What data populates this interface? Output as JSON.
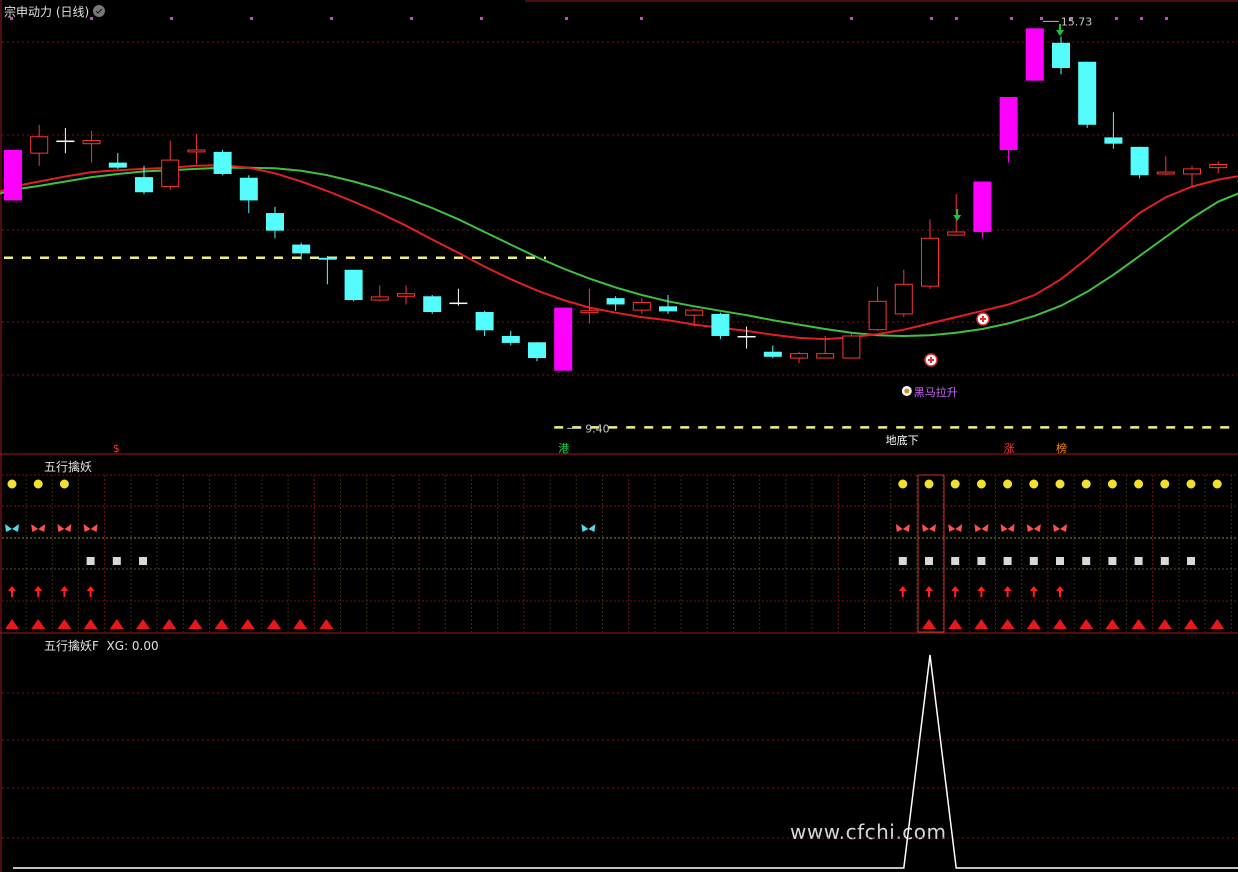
{
  "title": "宗申动力 (日线)",
  "indicator1_title": "五行擒妖",
  "indicator2_title": "五行擒妖F",
  "indicator2_value_label": "XG: 0.00",
  "watermark": "www.cfchi.com",
  "colors": {
    "up": "#ff3333",
    "down": "#54fcfc",
    "limit_up": "#ff00ff",
    "ma_fast": "#e02020",
    "ma_slow": "#40c040",
    "dash_line": "#f0f080",
    "grid_red": "#7a1010"
  },
  "chart_data": [
    {
      "type": "candlestick",
      "name": "price",
      "price_range": [
        9.2,
        16.1
      ],
      "high_label": "15.73",
      "low_label": "9.40",
      "dashed_levels": [
        {
          "price": 12.09,
          "from_index": 0,
          "to_index": 20
        },
        {
          "price": 9.4,
          "from_index": 21,
          "to_index": 47
        }
      ],
      "candles": [
        {
          "o": 13.0,
          "c": 13.8,
          "h": 13.8,
          "l": 13.0,
          "kind": "limit_up"
        },
        {
          "o": 13.75,
          "c": 14.01,
          "h": 14.2,
          "l": 13.55,
          "kind": "up"
        },
        {
          "o": 13.95,
          "c": 13.95,
          "h": 14.15,
          "l": 13.75,
          "kind": "doji"
        },
        {
          "o": 13.9,
          "c": 13.95,
          "h": 14.1,
          "l": 13.6,
          "kind": "up"
        },
        {
          "o": 13.6,
          "c": 13.52,
          "h": 13.75,
          "l": 13.5,
          "kind": "down"
        },
        {
          "o": 13.37,
          "c": 13.13,
          "h": 13.55,
          "l": 13.1,
          "kind": "down"
        },
        {
          "o": 13.22,
          "c": 13.64,
          "h": 13.95,
          "l": 13.17,
          "kind": "up"
        },
        {
          "o": 13.77,
          "c": 13.8,
          "h": 14.05,
          "l": 13.57,
          "kind": "up"
        },
        {
          "o": 13.77,
          "c": 13.42,
          "h": 13.8,
          "l": 13.4,
          "kind": "down"
        },
        {
          "o": 13.36,
          "c": 13.0,
          "h": 13.4,
          "l": 12.8,
          "kind": "down"
        },
        {
          "o": 12.8,
          "c": 12.52,
          "h": 12.9,
          "l": 12.4,
          "kind": "down"
        },
        {
          "o": 12.3,
          "c": 12.16,
          "h": 12.33,
          "l": 12.06,
          "kind": "down"
        },
        {
          "o": 12.09,
          "c": 12.06,
          "h": 12.12,
          "l": 11.67,
          "kind": "down"
        },
        {
          "o": 11.9,
          "c": 11.42,
          "h": 11.9,
          "l": 11.4,
          "kind": "down"
        },
        {
          "o": 11.42,
          "c": 11.47,
          "h": 11.65,
          "l": 11.4,
          "kind": "up"
        },
        {
          "o": 11.48,
          "c": 11.52,
          "h": 11.65,
          "l": 11.35,
          "kind": "up"
        },
        {
          "o": 11.48,
          "c": 11.23,
          "h": 11.5,
          "l": 11.2,
          "kind": "down"
        },
        {
          "o": 11.38,
          "c": 11.38,
          "h": 11.6,
          "l": 11.33,
          "kind": "doji"
        },
        {
          "o": 11.23,
          "c": 10.94,
          "h": 11.25,
          "l": 10.85,
          "kind": "down"
        },
        {
          "o": 10.85,
          "c": 10.74,
          "h": 10.93,
          "l": 10.7,
          "kind": "down"
        },
        {
          "o": 10.75,
          "c": 10.5,
          "h": 10.75,
          "l": 10.45,
          "kind": "down"
        },
        {
          "o": 11.3,
          "c": 10.3,
          "h": 11.3,
          "l": 10.3,
          "kind": "limit_down"
        },
        {
          "o": 11.22,
          "c": 11.25,
          "h": 11.6,
          "l": 11.05,
          "kind": "up"
        },
        {
          "o": 11.45,
          "c": 11.35,
          "h": 11.48,
          "l": 11.25,
          "kind": "down"
        },
        {
          "o": 11.26,
          "c": 11.38,
          "h": 11.45,
          "l": 11.2,
          "kind": "up"
        },
        {
          "o": 11.32,
          "c": 11.24,
          "h": 11.5,
          "l": 11.2,
          "kind": "down"
        },
        {
          "o": 11.18,
          "c": 11.26,
          "h": 11.28,
          "l": 11.0,
          "kind": "up"
        },
        {
          "o": 11.2,
          "c": 10.85,
          "h": 11.22,
          "l": 10.8,
          "kind": "down"
        },
        {
          "o": 10.85,
          "c": 10.85,
          "h": 11.0,
          "l": 10.65,
          "kind": "doji"
        },
        {
          "o": 10.6,
          "c": 10.52,
          "h": 10.7,
          "l": 10.5,
          "kind": "down"
        },
        {
          "o": 10.5,
          "c": 10.57,
          "h": 10.6,
          "l": 10.42,
          "kind": "up"
        },
        {
          "o": 10.5,
          "c": 10.57,
          "h": 10.85,
          "l": 10.5,
          "kind": "up"
        },
        {
          "o": 10.5,
          "c": 10.85,
          "h": 10.9,
          "l": 10.5,
          "kind": "up"
        },
        {
          "o": 10.95,
          "c": 11.4,
          "h": 11.63,
          "l": 10.93,
          "kind": "up"
        },
        {
          "o": 11.2,
          "c": 11.67,
          "h": 11.9,
          "l": 11.15,
          "kind": "up"
        },
        {
          "o": 11.64,
          "c": 12.4,
          "h": 12.7,
          "l": 11.6,
          "kind": "up"
        },
        {
          "o": 12.45,
          "c": 12.5,
          "h": 13.1,
          "l": 12.45,
          "kind": "up"
        },
        {
          "o": 12.5,
          "c": 13.3,
          "h": 13.3,
          "l": 12.4,
          "kind": "limit_up"
        },
        {
          "o": 13.8,
          "c": 14.64,
          "h": 14.64,
          "l": 13.6,
          "kind": "limit_up"
        },
        {
          "o": 14.9,
          "c": 15.73,
          "h": 15.73,
          "l": 14.9,
          "kind": "limit_up"
        },
        {
          "o": 15.5,
          "c": 15.1,
          "h": 15.6,
          "l": 15.0,
          "kind": "down"
        },
        {
          "o": 15.2,
          "c": 14.2,
          "h": 15.2,
          "l": 14.15,
          "kind": "down"
        },
        {
          "o": 14.0,
          "c": 13.9,
          "h": 14.4,
          "l": 13.82,
          "kind": "down"
        },
        {
          "o": 13.85,
          "c": 13.4,
          "h": 13.85,
          "l": 13.35,
          "kind": "down"
        },
        {
          "o": 13.42,
          "c": 13.45,
          "h": 13.7,
          "l": 13.4,
          "kind": "up"
        },
        {
          "o": 13.42,
          "c": 13.5,
          "h": 13.55,
          "l": 13.2,
          "kind": "up"
        },
        {
          "o": 13.52,
          "c": 13.57,
          "h": 13.62,
          "l": 13.43,
          "kind": "up"
        }
      ],
      "ma_fast": [
        13.22,
        13.3,
        13.38,
        13.45,
        13.48,
        13.5,
        13.52,
        13.55,
        13.56,
        13.52,
        13.43,
        13.3,
        13.15,
        12.98,
        12.8,
        12.6,
        12.38,
        12.17,
        11.95,
        11.75,
        11.57,
        11.42,
        11.3,
        11.22,
        11.15,
        11.1,
        11.03,
        10.98,
        10.93,
        10.87,
        10.82,
        10.8,
        10.83,
        10.88,
        10.95,
        11.05,
        11.15,
        11.25,
        11.35,
        11.5,
        11.75,
        12.08,
        12.45,
        12.8,
        13.05,
        13.22,
        13.33,
        13.4
      ],
      "ma_slow": [
        13.17,
        13.23,
        13.3,
        13.37,
        13.42,
        13.46,
        13.48,
        13.5,
        13.52,
        13.52,
        13.51,
        13.47,
        13.4,
        13.3,
        13.18,
        13.04,
        12.88,
        12.7,
        12.5,
        12.3,
        12.1,
        11.92,
        11.76,
        11.62,
        11.5,
        11.4,
        11.32,
        11.25,
        11.18,
        11.1,
        11.03,
        10.96,
        10.9,
        10.86,
        10.85,
        10.86,
        10.9,
        10.96,
        11.05,
        11.17,
        11.33,
        11.55,
        11.82,
        12.12,
        12.42,
        12.72,
        12.98,
        13.15
      ],
      "annotations": [
        {
          "index": 4,
          "text": "$",
          "color": "#ff3333"
        },
        {
          "index": 21,
          "text": "港",
          "color": "#00cc44"
        },
        {
          "index": 33,
          "text": "地底下",
          "color": "#ffffff"
        },
        {
          "index": 34,
          "text": "黑马拉升",
          "color": "#cc66ff"
        },
        {
          "index": 38,
          "text": "涨",
          "color": "#ff3333"
        },
        {
          "index": 40,
          "text": "榜",
          "color": "#ff8800"
        }
      ]
    },
    {
      "type": "signal_grid",
      "name": "五行擒妖",
      "rows": [
        "dot",
        "butterfly",
        "square",
        "arrow",
        "triangle"
      ],
      "dot": [
        0,
        1,
        2,
        34,
        35,
        36,
        37,
        38,
        39,
        40,
        41,
        42,
        43,
        44,
        45,
        46
      ],
      "butterfly_cyan": [
        0,
        22
      ],
      "butterfly_red": [
        1,
        2,
        3,
        34,
        35,
        36,
        37,
        38,
        39,
        40
      ],
      "square": [
        3,
        4,
        5,
        34,
        35,
        36,
        37,
        38,
        39,
        40,
        41,
        42,
        43,
        44,
        45
      ],
      "arrow": [
        0,
        1,
        2,
        3,
        34,
        35,
        36,
        37,
        38,
        39,
        40
      ],
      "triangle": [
        0,
        1,
        2,
        3,
        4,
        5,
        6,
        7,
        8,
        9,
        10,
        11,
        12,
        35,
        36,
        37,
        38,
        39,
        40,
        41,
        42,
        43,
        44,
        45,
        46
      ]
    },
    {
      "type": "line",
      "name": "五行擒妖F",
      "series": [
        {
          "name": "XG",
          "values": [
            0,
            0,
            0,
            0,
            0,
            0,
            0,
            0,
            0,
            0,
            0,
            0,
            0,
            0,
            0,
            0,
            0,
            0,
            0,
            0,
            0,
            0,
            0,
            0,
            0,
            0,
            0,
            0,
            0,
            0,
            0,
            0,
            0,
            0,
            0,
            1,
            0,
            0,
            0,
            0,
            0,
            0,
            0,
            0,
            0,
            0,
            0,
            0
          ]
        }
      ],
      "ylim": [
        0,
        1
      ]
    }
  ]
}
